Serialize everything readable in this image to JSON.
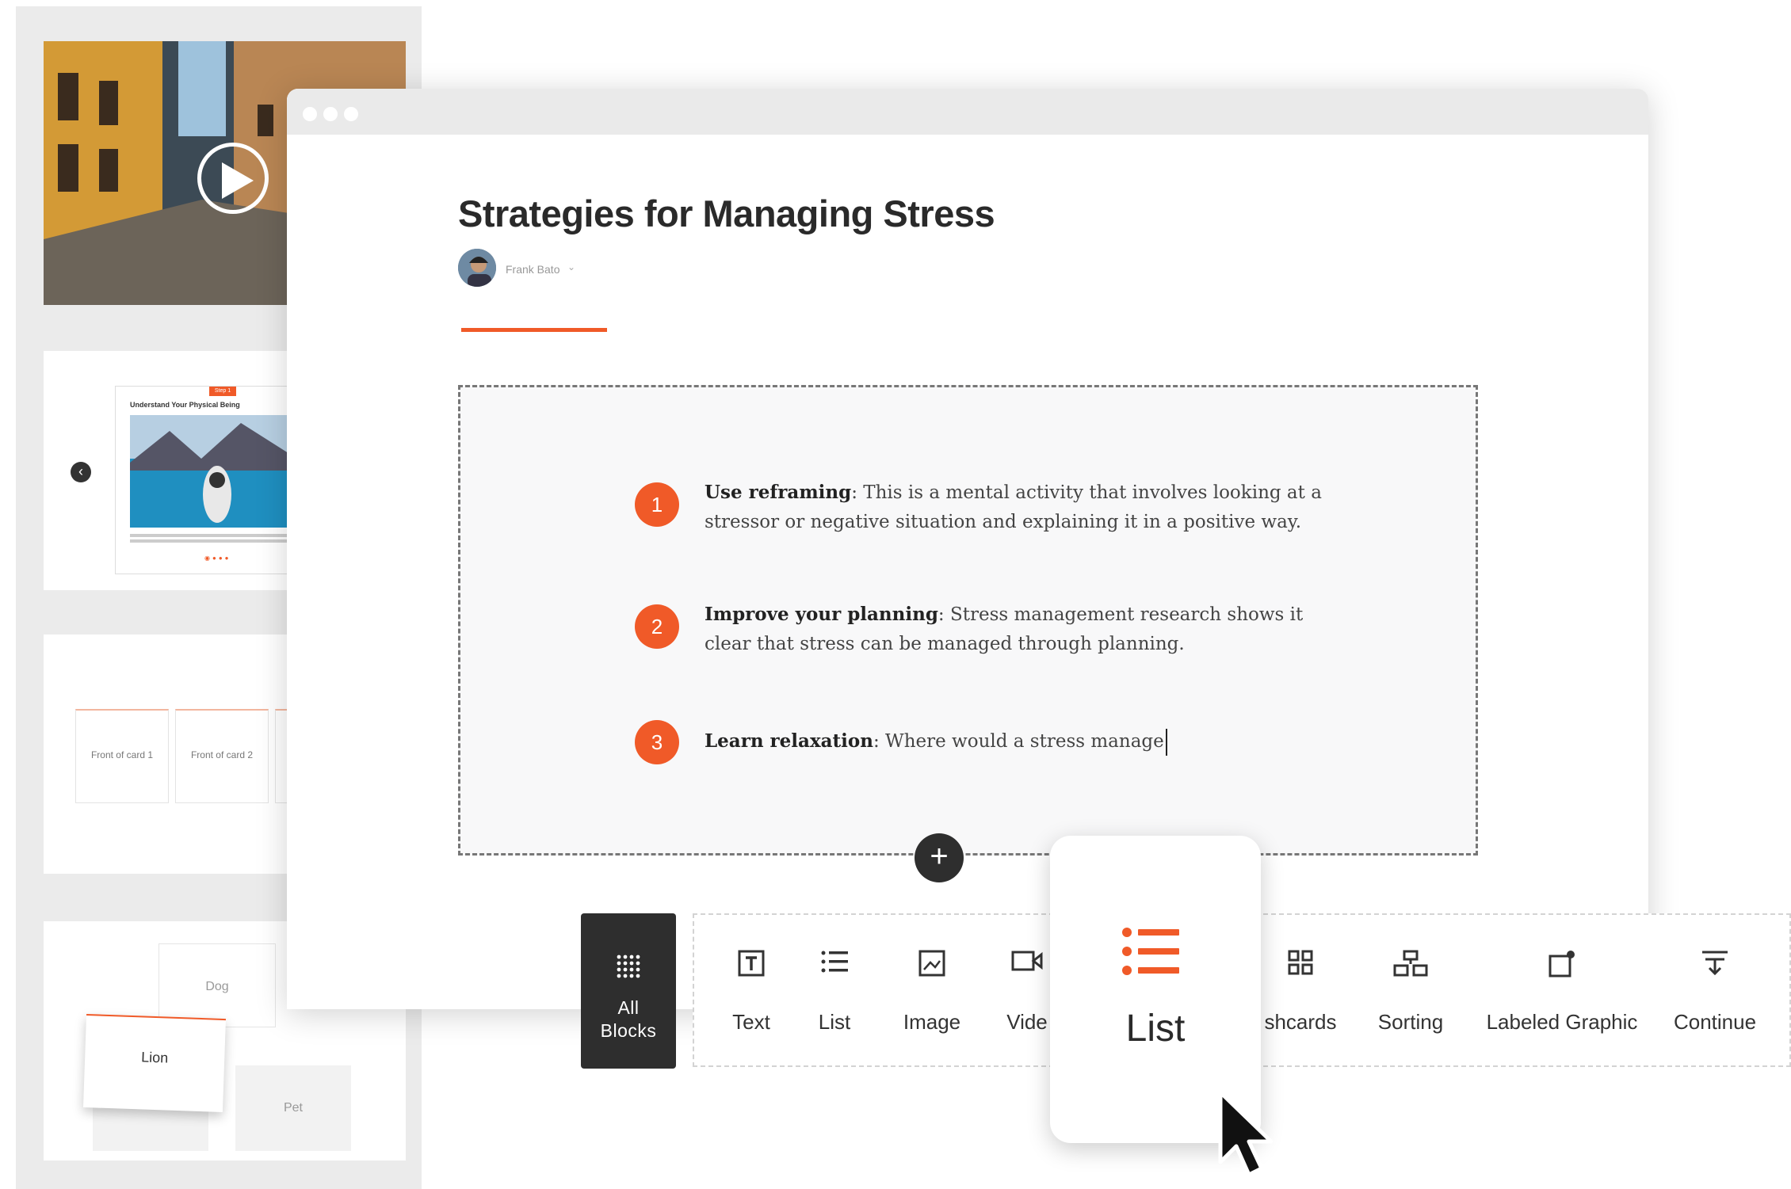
{
  "sidebar": {
    "carousel": {
      "step_badge": "Step 1",
      "card_title": "Understand Your Physical Being"
    },
    "flashcards": [
      {
        "label": "Front of card 1"
      },
      {
        "label": "Front of card 2"
      }
    ],
    "sorting": {
      "cards": [
        {
          "label": "Dog"
        },
        {
          "label": "Lion"
        },
        {
          "label": "Pet"
        }
      ]
    }
  },
  "lesson": {
    "title": "Strategies for Managing Stress",
    "author": "Frank Bato",
    "items": [
      {
        "number": "1",
        "heading": "Use reframing",
        "text": ": This is a mental activity that involves looking at a stressor or negative situation and explaining it in a positive way."
      },
      {
        "number": "2",
        "heading": "Improve your planning",
        "text": ": Stress management research shows it clear that stress can be managed through planning."
      },
      {
        "number": "3",
        "heading": "Learn relaxation",
        "text": ": Where would a stress manage"
      }
    ]
  },
  "toolbar": {
    "all_blocks_line1": "All",
    "all_blocks_line2": "Blocks",
    "blocks": [
      {
        "label": "Text",
        "icon": "text-icon"
      },
      {
        "label": "List",
        "icon": "list-icon"
      },
      {
        "label": "Image",
        "icon": "image-icon"
      },
      {
        "label": "Vide",
        "icon": "video-icon"
      },
      {
        "label": "shcards",
        "icon": "flashcards-icon"
      },
      {
        "label": "Sorting",
        "icon": "sorting-icon"
      },
      {
        "label": "Labeled Graphic",
        "icon": "labeled-graphic-icon"
      },
      {
        "label": "Continue",
        "icon": "continue-icon"
      }
    ],
    "hover_popup": {
      "label": "List",
      "icon": "list-icon"
    }
  },
  "colors": {
    "accent": "#f05a28",
    "dark": "#2e2e2e"
  }
}
